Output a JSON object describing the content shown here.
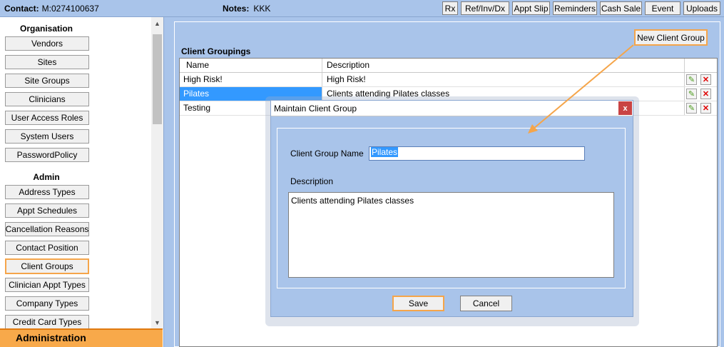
{
  "topbar": {
    "contact_label": "Contact:",
    "contact_value": "M:0274100637",
    "notes_label": "Notes:",
    "notes_value": "KKK",
    "buttons": [
      "Rx",
      "Ref/Inv/Dx",
      "Appt Slip",
      "Reminders",
      "Cash Sale",
      "Event",
      "Uploads"
    ]
  },
  "sidebar": {
    "organisation_heading": "Organisation",
    "organisation_items": [
      "Vendors",
      "Sites",
      "Site Groups",
      "Clinicians",
      "User Access Roles",
      "System Users",
      "PasswordPolicy"
    ],
    "admin_heading": "Admin",
    "admin_items": [
      "Address Types",
      "Appt Schedules",
      "Cancellation Reasons",
      "Contact Position",
      "Client Groups",
      "Clinician Appt Types",
      "Company Types",
      "Credit Card Types"
    ],
    "active_item": "Client Groups",
    "footer": "Administration"
  },
  "main": {
    "new_button": "New Client Group",
    "grid_title": "Client Groupings",
    "columns": [
      "Name",
      "Description"
    ],
    "rows": [
      {
        "name": "High Risk!",
        "description": "High Risk!"
      },
      {
        "name": "Pilates",
        "description": "Clients attending Pilates classes"
      },
      {
        "name": "Testing",
        "description": ""
      }
    ],
    "selected_row": "Pilates"
  },
  "dialog": {
    "title": "Maintain Client Group",
    "close_glyph": "x",
    "name_label": "Client Group Name",
    "name_value": "Pilates",
    "description_label": "Description",
    "description_value": "Clients attending Pilates classes",
    "save_label": "Save",
    "cancel_label": "Cancel"
  },
  "icons": {
    "edit": "pencil-icon",
    "delete": "delete-x-icon"
  },
  "colors": {
    "accent": "#f5a54a",
    "background": "#a9c4ea",
    "selection": "#3399ff",
    "delete": "#e00000"
  }
}
